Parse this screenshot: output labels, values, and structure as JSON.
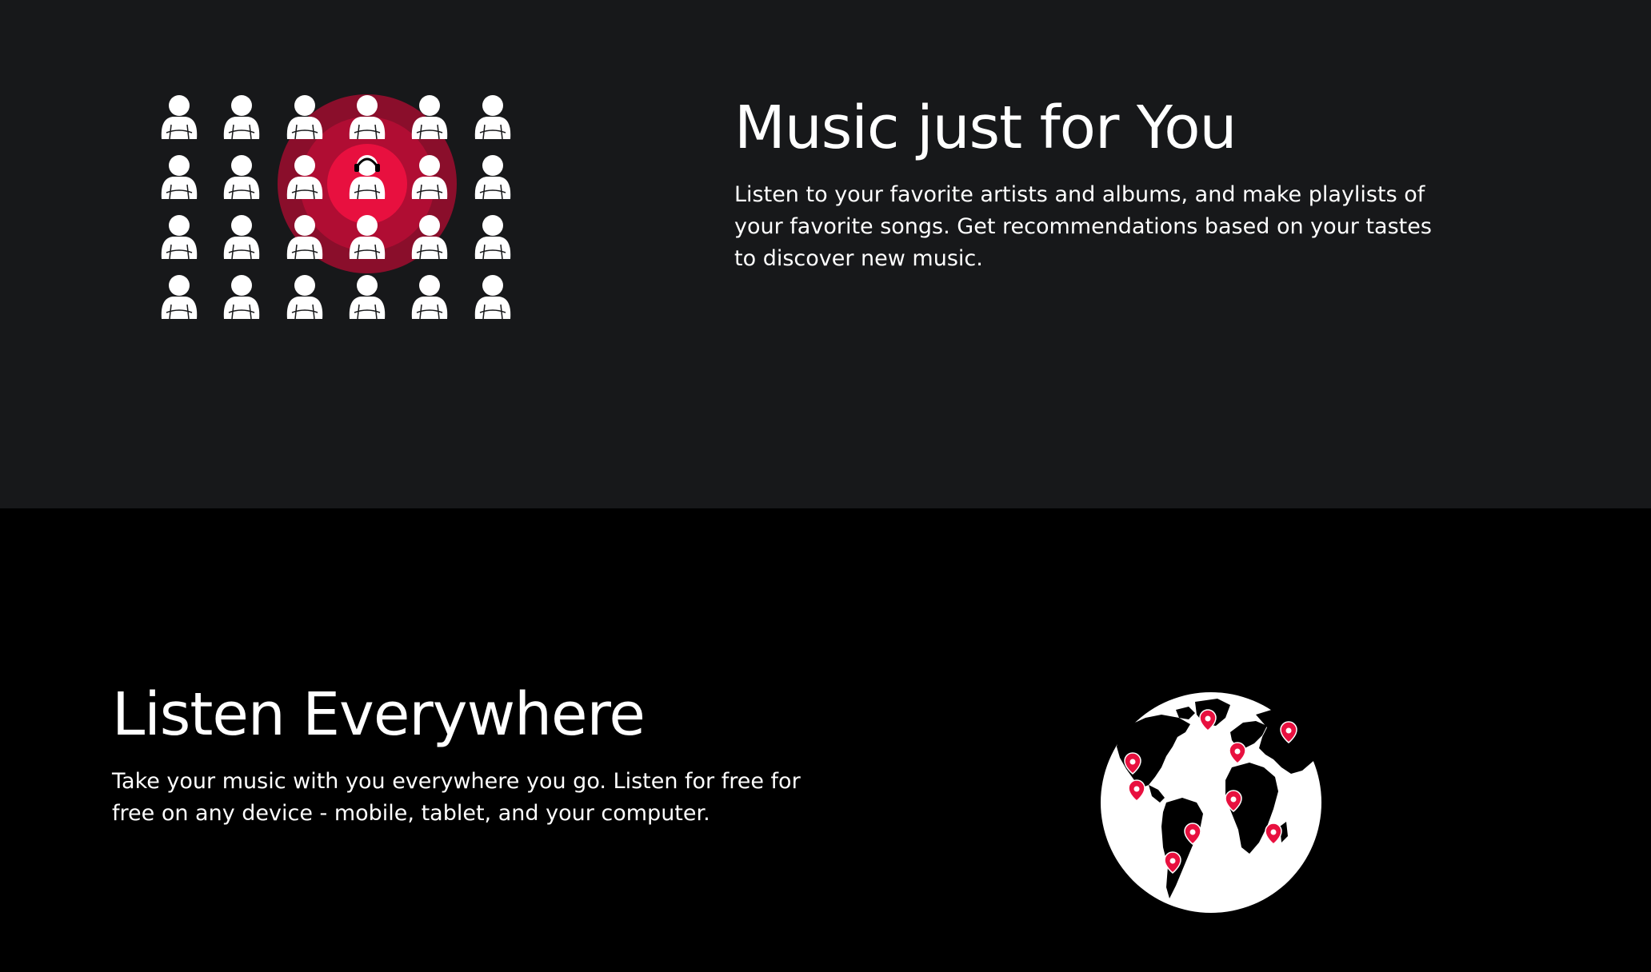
{
  "features": [
    {
      "heading": "Music just for You",
      "body": "Listen to your favorite artists and albums, and make playlists of your favorite songs. Get recommendations based on your tastes to discover new music.",
      "illustration": "people-target-illustration"
    },
    {
      "heading": "Listen Everywhere",
      "body": "Take your music with you everywhere you go. Listen for free for free on any device - mobile, tablet, and your computer.",
      "illustration": "globe-pins-illustration"
    }
  ],
  "colors": {
    "top_background": "#17181a",
    "bottom_background": "#000000",
    "accent": "#e8103f",
    "accent_mid": "#b00d33",
    "accent_dark": "#8a0e2b",
    "text": "#ffffff"
  }
}
